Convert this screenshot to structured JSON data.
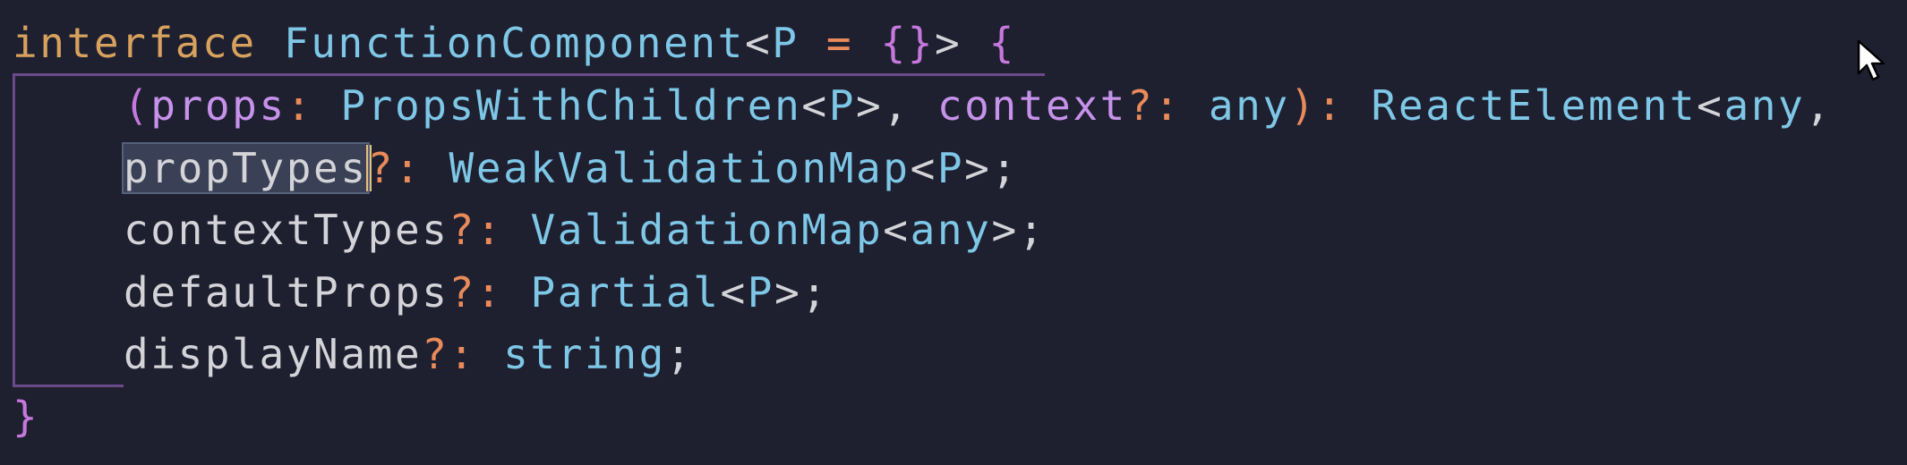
{
  "editor": {
    "lines": [
      {
        "tokens": {
          "t1": "interface",
          "t2": " ",
          "t3": "FunctionComponent",
          "t4": "<",
          "t5": "P",
          "t6": " = ",
          "t7": "{}",
          "t8": "> ",
          "t9": "{"
        }
      },
      {
        "tokens": {
          "t1": "(",
          "t2": "props",
          "t3": ": ",
          "t4": "PropsWithChildren",
          "t5": "<",
          "t6": "P",
          "t7": ">, ",
          "t8": "context",
          "t9": "?: ",
          "t10": "any",
          "t11": "): ",
          "t12": "ReactElement",
          "t13": "<",
          "t14": "any",
          "t15": ","
        }
      },
      {
        "tokens": {
          "t1": "propTypes",
          "t2": "?: ",
          "t3": "WeakValidationMap",
          "t4": "<",
          "t5": "P",
          "t6": ">;"
        }
      },
      {
        "tokens": {
          "t1": "contextTypes",
          "t2": "?: ",
          "t3": "ValidationMap",
          "t4": "<",
          "t5": "any",
          "t6": ">;"
        }
      },
      {
        "tokens": {
          "t1": "defaultProps",
          "t2": "?: ",
          "t3": "Partial",
          "t4": "<",
          "t5": "P",
          "t6": ">;"
        }
      },
      {
        "tokens": {
          "t1": "displayName",
          "t2": "?: ",
          "t3": "string",
          "t4": ";"
        }
      },
      {
        "tokens": {
          "t1": "}"
        }
      }
    ],
    "colors": {
      "background": "#1e2030",
      "keyword": "#d8a25e",
      "type": "#7ec7e6",
      "property": "#d4d4d8",
      "parameter": "#c792ea",
      "operator": "#e98a5a",
      "brace": "#c678dd",
      "caret": "#e5c07b",
      "bracket_guide": "#6b4a8a",
      "selection": "#3a4156"
    },
    "selected_word": "propTypes",
    "mouse_cursor_icon": "arrow-cursor-icon"
  }
}
